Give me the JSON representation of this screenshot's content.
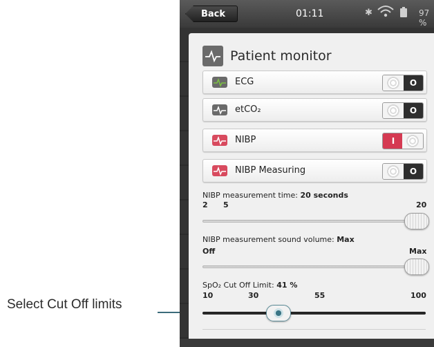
{
  "annotation": {
    "label": "Select Cut Off limits"
  },
  "status_bar": {
    "back_label": "Back",
    "time": "01:11",
    "battery": "97 %"
  },
  "panel": {
    "title": "Patient monitor",
    "rows": [
      {
        "label": "ECG",
        "icon": "ecg-waveform-icon",
        "icon_color": "#6a6a6a",
        "wave_color": "#7cc242",
        "state": "off",
        "off_label": "O"
      },
      {
        "label": "etCO₂",
        "icon": "co2-waveform-icon",
        "icon_color": "#6a6a6a",
        "wave_color": "#ffffff",
        "state": "off",
        "off_label": "O"
      },
      {
        "label": "NIBP",
        "icon": "nibp-waveform-icon",
        "icon_color": "#d84a5e",
        "wave_color": "#ffffff",
        "state": "on",
        "on_label": "I"
      },
      {
        "label": "NIBP Measuring",
        "icon": "nibp-measuring-icon",
        "icon_color": "#d84a5e",
        "wave_color": "#ffffff",
        "state": "off",
        "off_label": "O"
      }
    ],
    "sliders": [
      {
        "title": "NIBP measurement time: ",
        "value_text": "20 seconds",
        "ticks": [
          "2",
          "5",
          "20"
        ],
        "value_fraction": 1.0
      },
      {
        "title": "NIBP measurement sound volume: ",
        "value_text": "Max",
        "ticks": [
          "Off",
          "Max"
        ],
        "value_fraction": 1.0
      },
      {
        "title": "SpO₂ Cut Off Limit: ",
        "value_text": "41 %",
        "ticks": [
          "10",
          "30",
          "55",
          "100"
        ],
        "value_fraction": 0.35
      }
    ]
  },
  "colors": {
    "accent_teal": "#3b7585",
    "toggle_on": "#d53a52",
    "toggle_off": "#2e2e2e"
  }
}
